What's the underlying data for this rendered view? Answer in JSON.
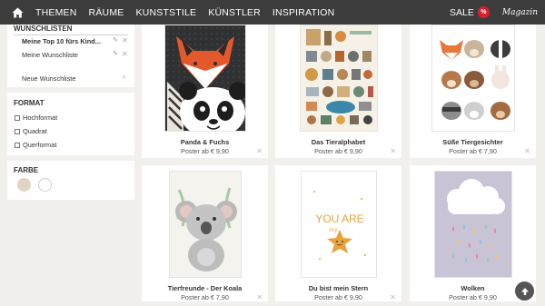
{
  "nav": {
    "items": [
      "THEMEN",
      "RÄUME",
      "KUNSTSTILE",
      "KÜNSTLER",
      "INSPIRATION"
    ],
    "sale_label": "SALE",
    "sale_badge": "%",
    "magazin": "Magazin"
  },
  "wishlists": {
    "title": "WUNSCHLISTEN",
    "items": [
      {
        "label": "Meine Top 10 fürs Kind...",
        "active": true
      },
      {
        "label": "Meine Wunschliste",
        "active": false
      }
    ],
    "new_label": "Neue Wunschliste"
  },
  "format": {
    "title": "FORMAT",
    "options": [
      "Hochformat",
      "Quadrat",
      "Querformat"
    ]
  },
  "farbe": {
    "title": "FARBE",
    "swatches": [
      "#e0d5c4",
      "#ffffff"
    ]
  },
  "products": [
    {
      "title": "Panda & Fuchs",
      "price": "Poster ab € 9,90"
    },
    {
      "title": "Das Tieralphabet",
      "price": "Poster ab € 9,90"
    },
    {
      "title": "Süße Tiergesichter",
      "price": "Poster ab € 7,90"
    },
    {
      "title": "Tierfreunde - Der Koala",
      "price": "Poster ab € 7,90"
    },
    {
      "title": "Du bist mein Stern",
      "price": "Poster ab € 9,90"
    },
    {
      "title": "Wolken",
      "price": "Poster ab € 9,90"
    }
  ],
  "poster_text": {
    "stern_line1": "YOU ARE",
    "stern_line2": "my"
  },
  "colors": {
    "nav_bg": "#3c3c3c",
    "page_bg": "#f2f0ed",
    "sale_badge": "#d9202a",
    "star": "#e8a33c"
  }
}
